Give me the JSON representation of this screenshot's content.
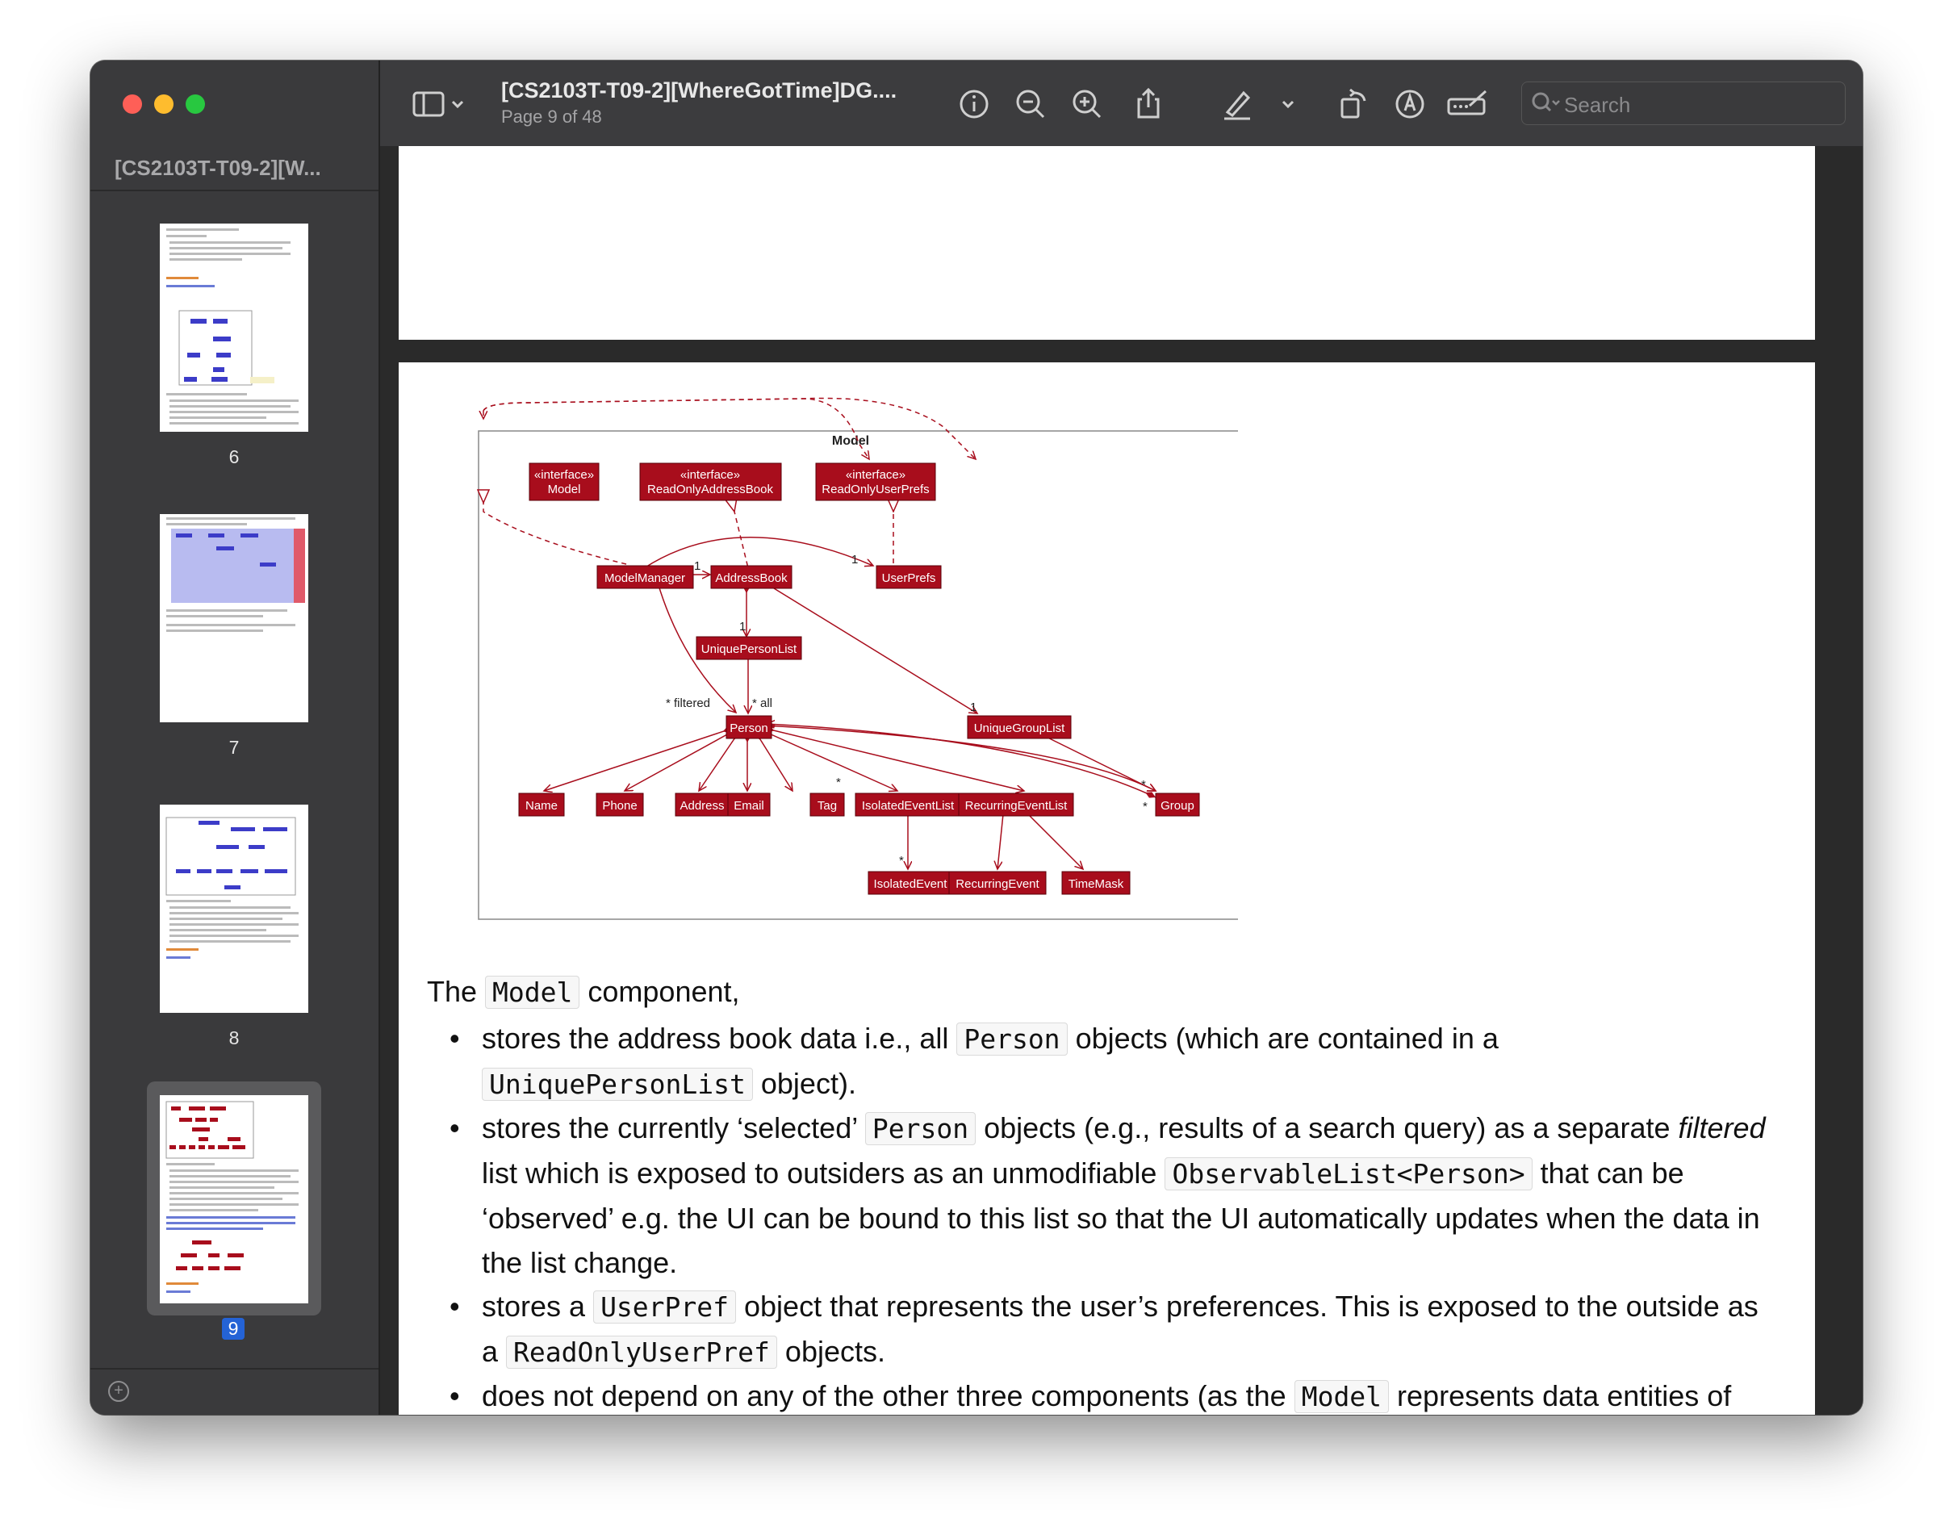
{
  "window": {
    "sidebar_title": "[CS2103T-T09-2][W...",
    "doc_title": "[CS2103T-T09-2][WhereGotTime]DG....",
    "page_indicator": "Page 9 of 48",
    "search_placeholder": "Search"
  },
  "thumbnails": [
    {
      "page": "6"
    },
    {
      "page": "7"
    },
    {
      "page": "8"
    },
    {
      "page": "9",
      "selected": true
    }
  ],
  "diagram": {
    "frame_label": "Model",
    "interface_model": [
      "«interface»",
      "Model"
    ],
    "interface_rab": [
      "«interface»",
      "ReadOnlyAddressBook"
    ],
    "interface_rup": [
      "«interface»",
      "ReadOnlyUserPrefs"
    ],
    "model_manager": "ModelManager",
    "address_book": "AddressBook",
    "user_prefs": "UserPrefs",
    "unique_person_list": "UniquePersonList",
    "unique_group_list": "UniqueGroupList",
    "person": "Person",
    "name": "Name",
    "phone": "Phone",
    "address": "Address",
    "email": "Email",
    "tag": "Tag",
    "isolated_event_list": "IsolatedEventList",
    "recurring_event_list": "RecurringEventList",
    "group": "Group",
    "isolated_event": "IsolatedEvent",
    "recurring_event": "RecurringEvent",
    "time_mask": "TimeMask",
    "mult_one": "1",
    "mult_star": "*",
    "filtered": "* filtered",
    "all": "* all"
  },
  "text": {
    "intro_pre": "The ",
    "intro_code": "Model",
    "intro_post": " component,",
    "b1_pre": "stores the address book data i.e., all ",
    "b1_code1": "Person",
    "b1_mid": " objects (which are contained in a",
    "b1_code2": "UniquePersonList",
    "b1_post": " object).",
    "b2_pre": "stores the currently ‘selected’ ",
    "b2_code1": "Person",
    "b2_mid": " objects (e.g., results of a search query) as a separate ",
    "b2_em": "filtered",
    "b2_line2_pre": "list which is exposed to outsiders as an unmodifiable ",
    "b2_code2": "ObservableList<Person>",
    "b2_line2_post": " that can be",
    "b2_line3": "‘observed’ e.g. the UI can be bound to this list so that the UI automatically updates when the data in",
    "b2_line4": "the list change.",
    "b3_pre": "stores a ",
    "b3_code1": "UserPref",
    "b3_mid": " object that represents the user’s preferences. This is exposed to the outside as",
    "b3_line2_pre": "a ",
    "b3_code2": "ReadOnlyUserPref",
    "b3_line2_post": " objects.",
    "b4_pre": "does not depend on any of the other three components (as the ",
    "b4_code": "Model",
    "b4_post": " represents data entities of"
  },
  "colors": {
    "node_fill": "#a80d1c",
    "node_text": "#ffffff",
    "edge": "#a80d1c"
  }
}
